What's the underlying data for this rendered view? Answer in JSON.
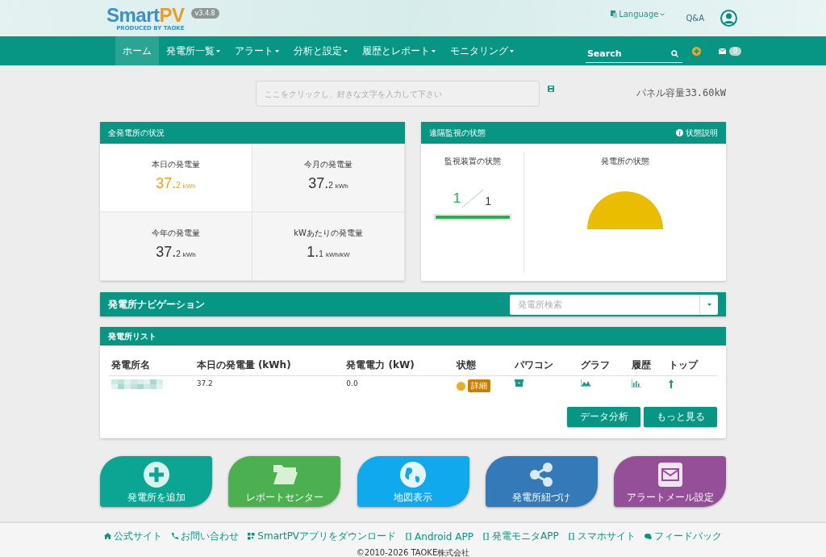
{
  "header": {
    "logo": {
      "smart": "Smart",
      "pv": "PV",
      "tagline": "PRODUCED BY TAOKE"
    },
    "version": "v3.4.8",
    "language": "Language",
    "qa": "Q&A"
  },
  "nav": {
    "items": [
      {
        "label": "ホーム",
        "selected": true,
        "dropdown": false
      },
      {
        "label": "発電所一覧",
        "selected": false,
        "dropdown": true
      },
      {
        "label": "アラート",
        "selected": false,
        "dropdown": true
      },
      {
        "label": "分析と設定",
        "selected": false,
        "dropdown": true
      },
      {
        "label": "履歴とレポート",
        "selected": false,
        "dropdown": true
      },
      {
        "label": "モニタリング",
        "selected": false,
        "dropdown": true
      }
    ],
    "search_placeholder": "Search",
    "mail_count": "0"
  },
  "memo": {
    "placeholder": "ここをクリックし、好きな文字を入力して下さい",
    "capacity": "パネル容量33.60kW"
  },
  "overview": {
    "title": "全発電所の状況",
    "stats": [
      {
        "label": "本日の発電量",
        "int": "37.",
        "dec": "2",
        "unit": "kWh",
        "highlight": true
      },
      {
        "label": "今月の発電量",
        "int": "37.",
        "dec": "2",
        "unit": "kWh",
        "highlight": false
      },
      {
        "label": "今年の発電量",
        "int": "37.",
        "dec": "2",
        "unit": "kWh",
        "highlight": false
      },
      {
        "label": "kWあたりの発電量",
        "int": "1.",
        "dec": "1",
        "unit": "kWh/kW",
        "highlight": false
      }
    ]
  },
  "remote": {
    "title": "遠隔監視の状態",
    "help": "状態説明",
    "devices": {
      "title": "監視装置の状態",
      "online": "1",
      "total": "1",
      "level": 1
    },
    "plants": {
      "title": "発電所の状態"
    }
  },
  "navigation": {
    "title": "発電所ナビゲーション",
    "search_placeholder": "発電所検索"
  },
  "plant_list": {
    "title": "発電所リスト",
    "columns": [
      "発電所名",
      "本日の発電量 (kWh)",
      "発電電力 (kW)",
      "状態",
      "パワコン",
      "グラフ",
      "履歴",
      "トップ"
    ],
    "rows": [
      {
        "today": "37.2",
        "power": "0.0",
        "color": "#e8b020",
        "detail": "詳細"
      }
    ],
    "buttons": [
      "データ分析",
      "もっと見る"
    ]
  },
  "tiles": [
    {
      "label": "発電所を追加",
      "kind": "add",
      "color": "#0aa593"
    },
    {
      "label": "レポートセンター",
      "kind": "folder",
      "color": "#4caf50"
    },
    {
      "label": "地図表示",
      "kind": "globe",
      "color": "#11a9ee"
    },
    {
      "label": "発電所紐づけ",
      "kind": "share",
      "color": "#3479b8"
    },
    {
      "label": "アラートメール設定",
      "kind": "mail",
      "color": "#944f98"
    }
  ],
  "footer": {
    "links": [
      {
        "label": "公式サイト",
        "kind": "home"
      },
      {
        "label": "お問い合わせ",
        "kind": "phone"
      },
      {
        "label": "SmartPVアプリをダウンロード",
        "kind": "qr"
      },
      {
        "label": "Android APP",
        "kind": "mobile"
      },
      {
        "label": "発電モニタAPP",
        "kind": "mobile"
      },
      {
        "label": "スマホサイト",
        "kind": "mobile"
      },
      {
        "label": "フィードバック",
        "kind": "chat"
      }
    ],
    "copyright": "©2010-2026 TAOKE株式会社"
  }
}
